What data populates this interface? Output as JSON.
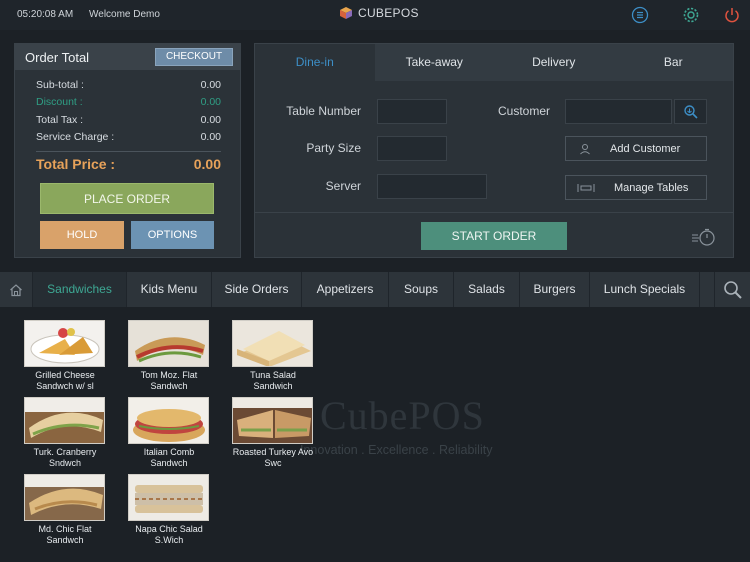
{
  "topbar": {
    "time": "05:20:08 AM",
    "welcome": "Welcome Demo",
    "brand": "CUBEPOS"
  },
  "order": {
    "title": "Order Total",
    "checkout": "CHECKOUT",
    "rows": [
      {
        "label": "Sub-total :",
        "value": "0.00"
      },
      {
        "label": "Discount :",
        "value": "0.00"
      },
      {
        "label": "Total Tax  :",
        "value": "0.00"
      },
      {
        "label": "Service Charge :",
        "value": "0.00"
      }
    ],
    "total_label": "Total Price :",
    "total_value": "0.00",
    "place_order": "PLACE ORDER",
    "hold": "HOLD",
    "options": "OPTIONS"
  },
  "order_type": {
    "tabs": [
      "Dine-in",
      "Take-away",
      "Delivery",
      "Bar"
    ],
    "table_number": "Table Number",
    "party_size": "Party Size",
    "server": "Server",
    "customer": "Customer",
    "add_customer": "Add Customer",
    "manage_tables": "Manage Tables",
    "start_order": "START ORDER"
  },
  "categories": [
    "Sandwiches",
    "Kids Menu",
    "Side Orders",
    "Appetizers",
    "Soups",
    "Salads",
    "Burgers",
    "Lunch Specials"
  ],
  "watermark": {
    "name": "CubePOS",
    "tagline": "Innovation . Excellence . Reliability"
  },
  "items": [
    {
      "label": "Grilled Cheese Sandwch w/ sl"
    },
    {
      "label": "Tom Moz. Flat Sandwch"
    },
    {
      "label": "Tuna Salad Sandwich"
    },
    {
      "label": "Turk. Cranberry Sndwch"
    },
    {
      "label": "Italian Comb Sandwch"
    },
    {
      "label": "Roasted Turkey Avo Swc"
    },
    {
      "label": "Md. Chic Flat Sandwch"
    },
    {
      "label": "Napa Chic Salad S.Wich"
    }
  ],
  "colors": {
    "accent_blue": "#3d8fc7",
    "accent_teal": "#3ea894",
    "total_orange": "#e7a25a",
    "power_red": "#e0533f"
  }
}
